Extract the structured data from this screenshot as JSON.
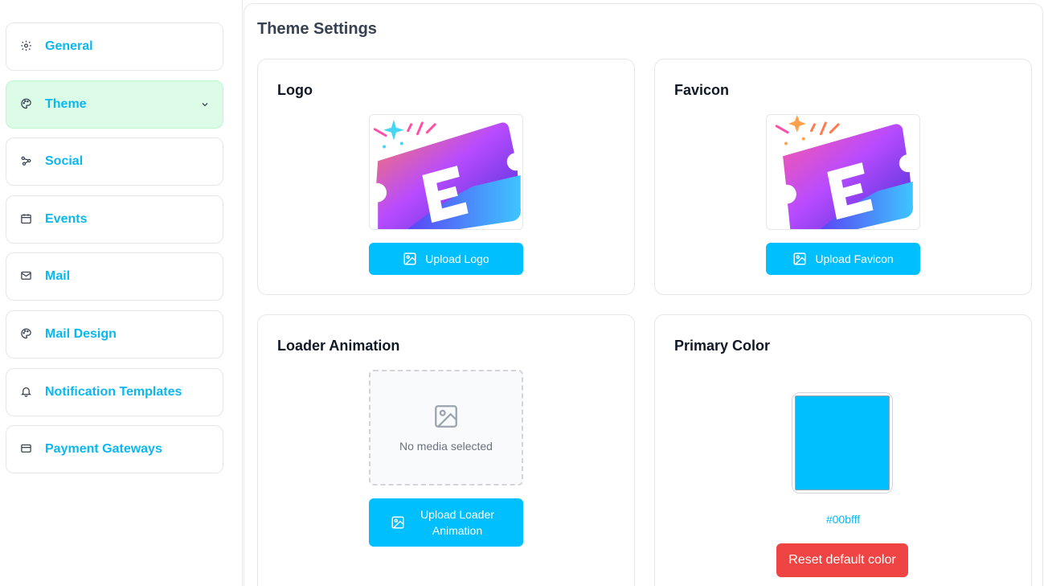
{
  "sidebar": {
    "items": [
      {
        "label": "General",
        "icon": "gear-icon"
      },
      {
        "label": "Theme",
        "icon": "palette-icon",
        "active": true
      },
      {
        "label": "Social",
        "icon": "share-icon"
      },
      {
        "label": "Events",
        "icon": "calendar-icon"
      },
      {
        "label": "Mail",
        "icon": "mail-icon"
      },
      {
        "label": "Mail Design",
        "icon": "palette-icon"
      },
      {
        "label": "Notification Templates",
        "icon": "bell-icon"
      },
      {
        "label": "Payment Gateways",
        "icon": "credit-card-icon"
      }
    ]
  },
  "main": {
    "title": "Theme Settings",
    "logo": {
      "title": "Logo",
      "button": "Upload Logo"
    },
    "favicon": {
      "title": "Favicon",
      "button": "Upload Favicon"
    },
    "loader": {
      "title": "Loader Animation",
      "empty": "No media selected",
      "button_line1": "Upload Loader",
      "button_line2": "Animation"
    },
    "primary_color": {
      "title": "Primary Color",
      "value": "#00bfff",
      "reset_button": "Reset default color"
    }
  },
  "colors": {
    "accent": "#00bfff",
    "active_bg": "#dcfce7",
    "reset": "#ef4444"
  }
}
